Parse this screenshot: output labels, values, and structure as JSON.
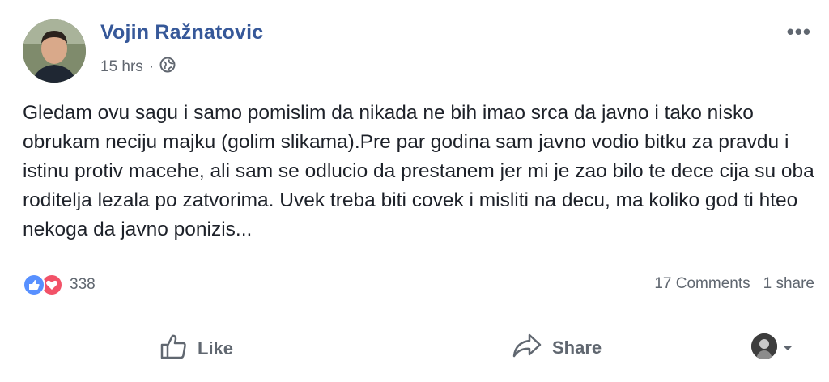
{
  "post": {
    "author": "Vojin Ražnatovic",
    "time": "15 hrs",
    "separator": "·",
    "privacy_icon": "globe-icon",
    "more_label": "•••",
    "text": "Gledam ovu sagu i samo pomislim da nikada ne bih imao srca da javno i tako nisko obrukam neciju majku (golim slikama).Pre par godina sam javno vodio bitku za pravdu i istinu protiv macehe, ali sam se odlucio da prestanem jer mi je zao bilo te dece cija su oba roditelja lezala po zatvorima. Uvek treba biti covek i misliti na decu, ma koliko god ti hteo nekoga da javno ponizis..."
  },
  "reactions": {
    "icons": [
      "like-reaction-icon",
      "love-reaction-icon"
    ],
    "count": "338"
  },
  "stats": {
    "comments": "17 Comments",
    "shares": "1 share"
  },
  "actions": {
    "like_label": "Like",
    "share_label": "Share"
  },
  "colors": {
    "author": "#365899",
    "like_reaction": "#5890ff",
    "love_reaction": "#f25268",
    "muted": "#606770"
  }
}
